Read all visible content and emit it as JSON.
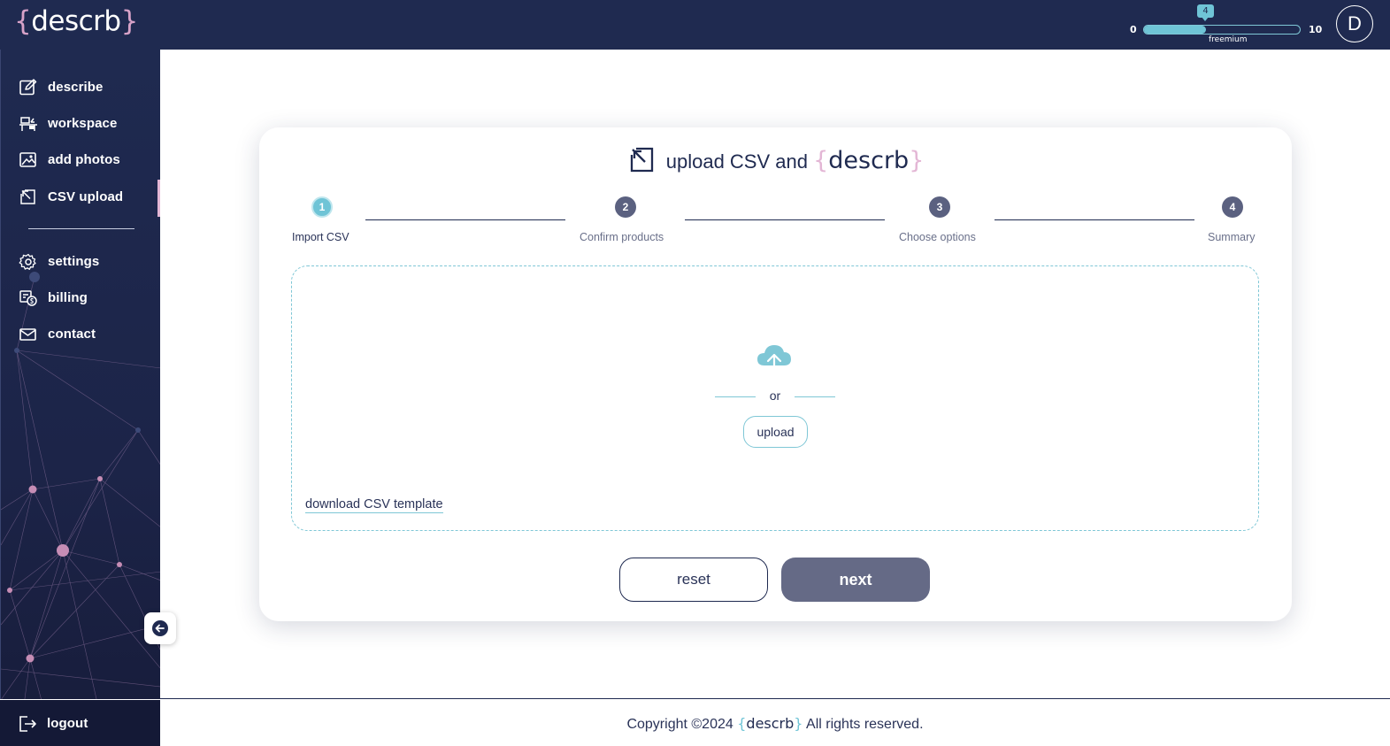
{
  "header": {
    "logo": {
      "brace_open": "{",
      "text": "descrb",
      "brace_close": "}"
    },
    "usage": {
      "min": "0",
      "max": "10",
      "current": "4",
      "current_value": 4,
      "max_value": 10,
      "plan": "freemium"
    },
    "avatar_initial": "D"
  },
  "sidebar": {
    "items": [
      {
        "label": "describe",
        "icon": "edit-square-icon"
      },
      {
        "label": "workspace",
        "icon": "workspace-desk-icon"
      },
      {
        "label": "add photos",
        "icon": "image-icon"
      },
      {
        "label": "CSV upload",
        "icon": "arrow-box-icon",
        "active": true
      }
    ],
    "secondary_items": [
      {
        "label": "settings",
        "icon": "gear-icon"
      },
      {
        "label": "billing",
        "icon": "billing-icon"
      },
      {
        "label": "contact",
        "icon": "envelope-icon"
      }
    ],
    "logout_label": "logout"
  },
  "card": {
    "title_prefix": "upload CSV and",
    "title_brand": {
      "brace_open": "{",
      "text": "descrb",
      "brace_close": "}"
    },
    "steps": [
      {
        "number": "1",
        "label": "Import CSV",
        "active": true
      },
      {
        "number": "2",
        "label": "Confirm products",
        "active": false
      },
      {
        "number": "3",
        "label": "Choose options",
        "active": false
      },
      {
        "number": "4",
        "label": "Summary",
        "active": false
      }
    ],
    "dropzone": {
      "or_text": "or",
      "upload_label": "upload",
      "template_link": "download CSV template"
    },
    "reset_label": "reset",
    "next_label": "next"
  },
  "footer": {
    "prefix": "Copyright ©2024",
    "brand": {
      "brace_open": "{",
      "text": "descrb",
      "brace_close": "}"
    },
    "suffix": "All rights reserved."
  },
  "colors": {
    "navy": "#1f2a50",
    "accent_teal": "#6fc4d6",
    "accent_pink": "#e3b6d5",
    "button_gray": "#656a86"
  }
}
